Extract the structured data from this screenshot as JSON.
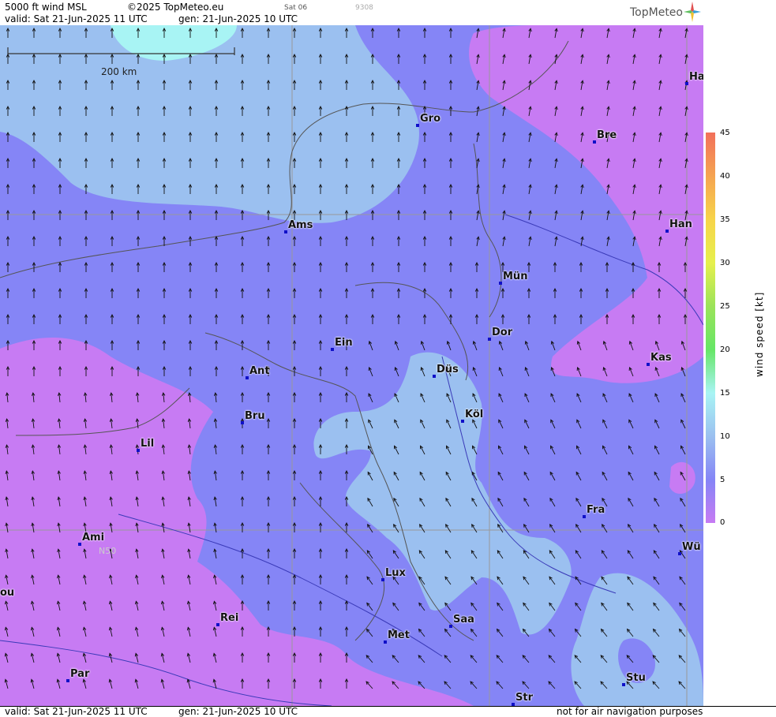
{
  "header": {
    "title": "5000 ft wind MSL",
    "copyright": "©2025 TopMeteo.eu",
    "day": "Sat 06",
    "code": "9308",
    "valid": "valid:  Sat  21-Jun-2025  11 UTC",
    "gen": "gen: 21-Jun-2025 10 UTC"
  },
  "logo": {
    "text": "TopMeteo",
    "icon": "compass-star-icon"
  },
  "footer": {
    "valid": "valid:  Sat  21-Jun-2025  11 UTC",
    "gen": "gen: 21-Jun-2025 10 UTC",
    "disclaimer": "not for air navigation purposes"
  },
  "map": {
    "scale_label": "200 km",
    "grid_label": "N50",
    "cities": [
      "Gro",
      "Bre",
      "Ha",
      "Ams",
      "Han",
      "Mün",
      "Ein",
      "Dor",
      "Kas",
      "Ant",
      "Düs",
      "Bru",
      "Köl",
      "Lil",
      "Fra",
      "Ami",
      "Wü",
      "ou",
      "Lux",
      "Saa",
      "Rei",
      "Met",
      "Par",
      "Stu",
      "Str"
    ]
  },
  "legend": {
    "title": "wind speed [kt]",
    "ticks": [
      "45",
      "40",
      "35",
      "30",
      "25",
      "20",
      "15",
      "10",
      "5",
      "0"
    ],
    "colors": {
      "0": "#c77bf3",
      "5": "#8585f6",
      "10": "#9bc0f0",
      "15": "#a8f4f4",
      "20": "#66e666",
      "25": "#9be35a",
      "30": "#e6f04d",
      "35": "#f7d44a",
      "40": "#f5a451",
      "45": "#f2705a"
    }
  }
}
